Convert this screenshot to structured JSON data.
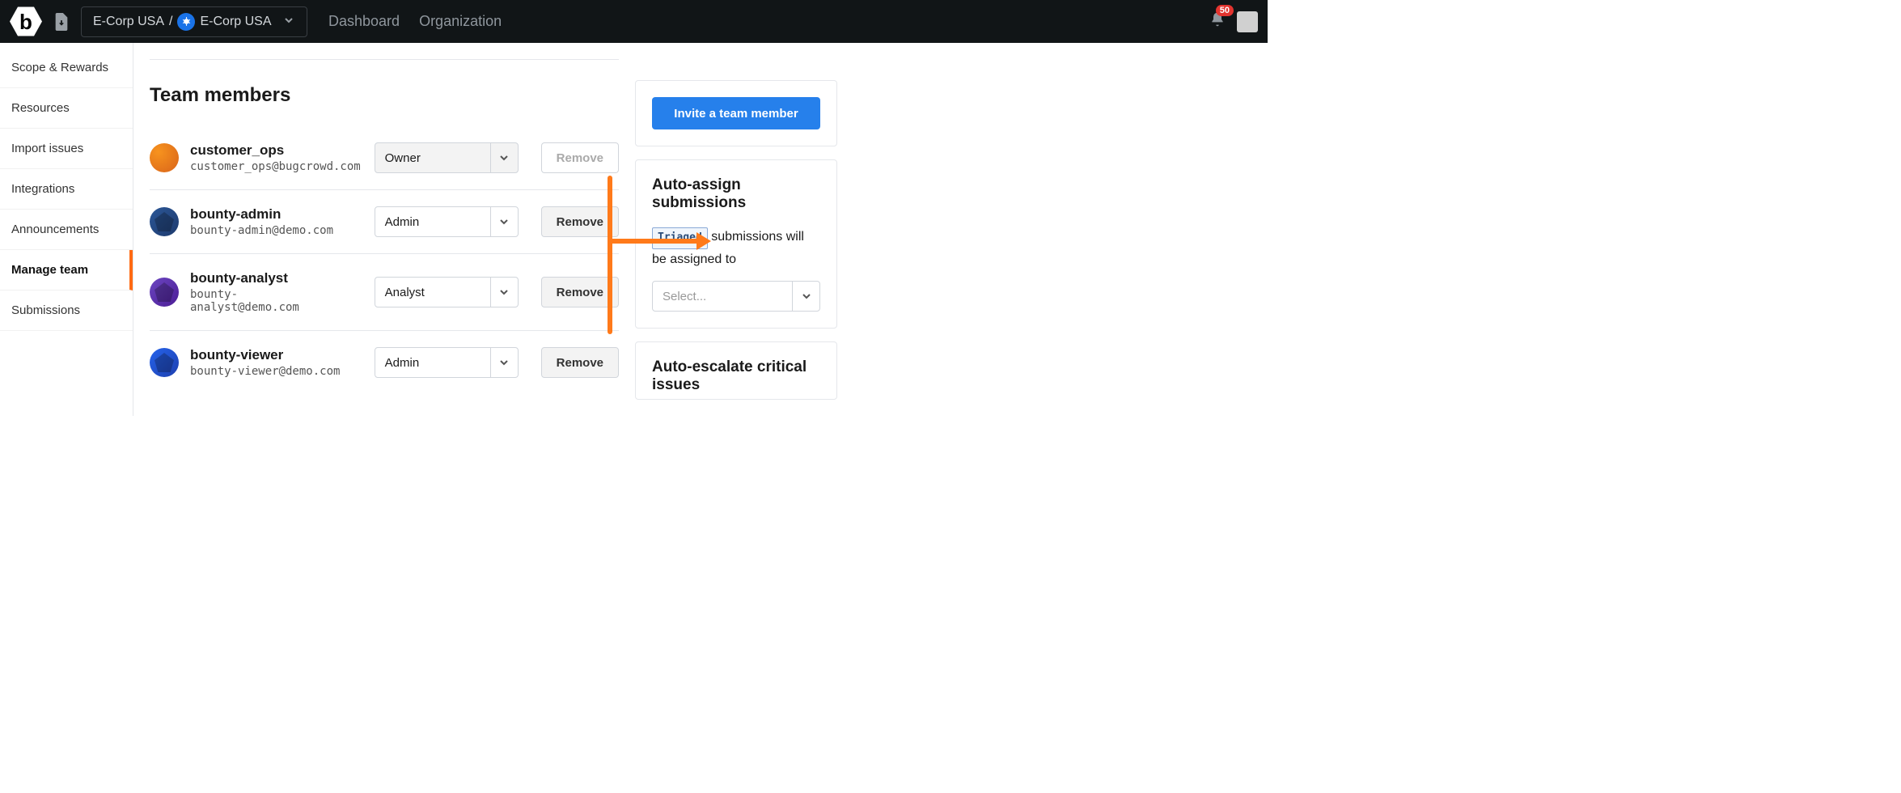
{
  "header": {
    "breadcrumb_org": "E-Corp USA",
    "breadcrumb_sep": "/",
    "breadcrumb_program": "E-Corp USA",
    "nav": {
      "dashboard": "Dashboard",
      "organization": "Organization"
    },
    "notification_count": "50"
  },
  "sidebar": {
    "items": [
      {
        "label": "Scope & Rewards"
      },
      {
        "label": "Resources"
      },
      {
        "label": "Import issues"
      },
      {
        "label": "Integrations"
      },
      {
        "label": "Announcements"
      },
      {
        "label": "Manage team"
      },
      {
        "label": "Submissions"
      }
    ]
  },
  "main": {
    "section_title": "Team members",
    "members": [
      {
        "name": "customer_ops",
        "email": "customer_ops@bugcrowd.com",
        "role": "Owner",
        "remove": "Remove"
      },
      {
        "name": "bounty-admin",
        "email": "bounty-admin@demo.com",
        "role": "Admin",
        "remove": "Remove"
      },
      {
        "name": "bounty-analyst",
        "email": "bounty-analyst@demo.com",
        "role": "Analyst",
        "remove": "Remove"
      },
      {
        "name": "bounty-viewer",
        "email": "bounty-viewer@demo.com",
        "role": "Admin",
        "remove": "Remove"
      }
    ]
  },
  "right": {
    "invite_label": "Invite a team member",
    "autoassign_title": "Auto-assign submissions",
    "triaged_tag": "Triaged",
    "autoassign_text": " submissions will be assigned to",
    "select_placeholder": "Select...",
    "autoescalate_title": "Auto-escalate critical issues"
  }
}
